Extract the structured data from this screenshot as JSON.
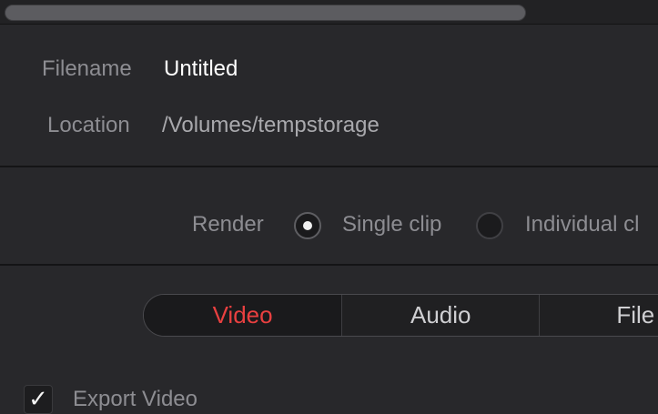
{
  "file": {
    "filename_label": "Filename",
    "filename_value": "Untitled",
    "location_label": "Location",
    "location_value": "/Volumes/tempstorage"
  },
  "render": {
    "label": "Render",
    "options": [
      {
        "label": "Single clip",
        "selected": true
      },
      {
        "label": "Individual cl",
        "selected": false
      }
    ]
  },
  "tabs": [
    {
      "label": "Video",
      "active": true
    },
    {
      "label": "Audio",
      "active": false
    },
    {
      "label": "File",
      "active": false
    }
  ],
  "export_video": {
    "label": "Export Video",
    "checked": true,
    "check_glyph": "✓"
  },
  "colors": {
    "background": "#28282b",
    "label_text": "#8d8d92",
    "active_tab": "#e94040"
  }
}
